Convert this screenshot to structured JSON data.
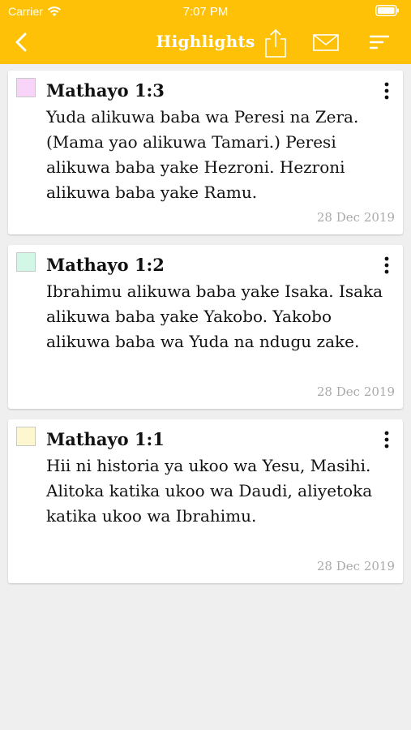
{
  "status_bar": {
    "carrier": "Carrier",
    "time": "7:07 PM"
  },
  "nav": {
    "title": "Highlights",
    "background_color": "#ffc107"
  },
  "highlights": [
    {
      "reference": "Mathayo 1:3",
      "text": "Yuda alikuwa baba wa Peresi na Zera. (Mama yao alikuwa Tamari.) Peresi alikuwa baba yake Hezroni. Hezroni alikuwa baba yake Ramu.",
      "date": "28 Dec 2019",
      "color": "#f9d4f9"
    },
    {
      "reference": "Mathayo 1:2",
      "text": "Ibrahimu alikuwa baba yake Isaka. Isaka alikuwa baba yake Yakobo. Yakobo alikuwa baba wa Yuda na ndugu zake.",
      "date": "28 Dec 2019",
      "color": "#d2f7e6"
    },
    {
      "reference": "Mathayo 1:1",
      "text": "Hii ni historia ya ukoo wa Yesu, Masihi. Alitoka katika ukoo wa Daudi, aliyetoka katika ukoo wa Ibrahimu.",
      "date": "28 Dec 2019",
      "color": "#fcf7cf"
    }
  ]
}
